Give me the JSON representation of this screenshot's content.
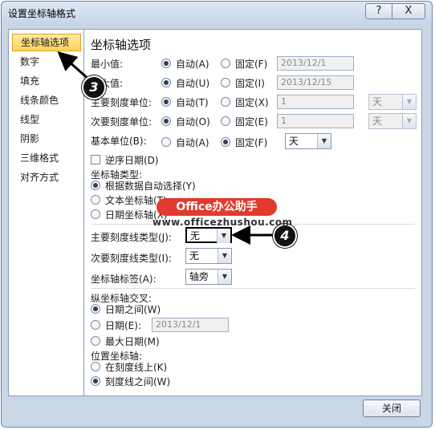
{
  "window": {
    "title": "设置坐标轴格式",
    "help_glyph": "?",
    "close_glyph": "X"
  },
  "nav": {
    "items": [
      {
        "label": "坐标轴选项",
        "selected": true
      },
      {
        "label": "数字"
      },
      {
        "label": "填充"
      },
      {
        "label": "线条颜色"
      },
      {
        "label": "线型"
      },
      {
        "label": "阴影"
      },
      {
        "label": "三维格式"
      },
      {
        "label": "对齐方式"
      }
    ]
  },
  "panel": {
    "heading": "坐标轴选项",
    "min": {
      "label": "最小值:",
      "auto": "自动(A)",
      "fixed": "固定(F)",
      "value": "2013/12/1",
      "selected": "auto"
    },
    "max": {
      "label": "最大值:",
      "auto": "自动(U)",
      "fixed": "固定(I)",
      "value": "2013/12/15",
      "selected": "auto"
    },
    "major": {
      "label": "主要刻度单位:",
      "auto": "自动(T)",
      "fixed": "固定(X)",
      "value": "1",
      "unit": "天",
      "selected": "auto"
    },
    "minor": {
      "label": "次要刻度单位:",
      "auto": "自动(O)",
      "fixed": "固定(E)",
      "value": "1",
      "unit": "天",
      "selected": "auto"
    },
    "base": {
      "label": "基本单位(B):",
      "auto": "自动(A)",
      "fixed": "固定(F)",
      "unit": "天",
      "selected": "fixed"
    },
    "reverse": {
      "label": "逆序日期(D)",
      "checked": false
    },
    "axis_type": {
      "label": "坐标轴类型:",
      "options": [
        "根据数据自动选择(Y)",
        "文本坐标轴(T)",
        "日期坐标轴(X)"
      ],
      "selected": 0
    },
    "major_tick_type": {
      "label": "主要刻度线类型(J):",
      "value": "无"
    },
    "minor_tick_type": {
      "label": "次要刻度线类型(I):",
      "value": "无"
    },
    "axis_labels": {
      "label": "坐标轴标签(A):",
      "value": "轴旁"
    },
    "cross": {
      "label": "纵坐标轴交叉:",
      "options": [
        "日期之间(W)",
        "日期(E):",
        "最大日期(M)"
      ],
      "date_value": "2013/12/1",
      "selected": 0
    },
    "position": {
      "label": "位置坐标轴:",
      "options": [
        "在刻度线上(K)",
        "刻度线之间(W)"
      ],
      "selected": 1
    }
  },
  "footer": {
    "close_label": "关闭"
  },
  "annotations": {
    "badge_3": "3",
    "badge_4": "4",
    "watermark_title": "Office办公助手",
    "watermark_url": "www.officezhushou.com",
    "accent_color": "#e23a2e"
  }
}
